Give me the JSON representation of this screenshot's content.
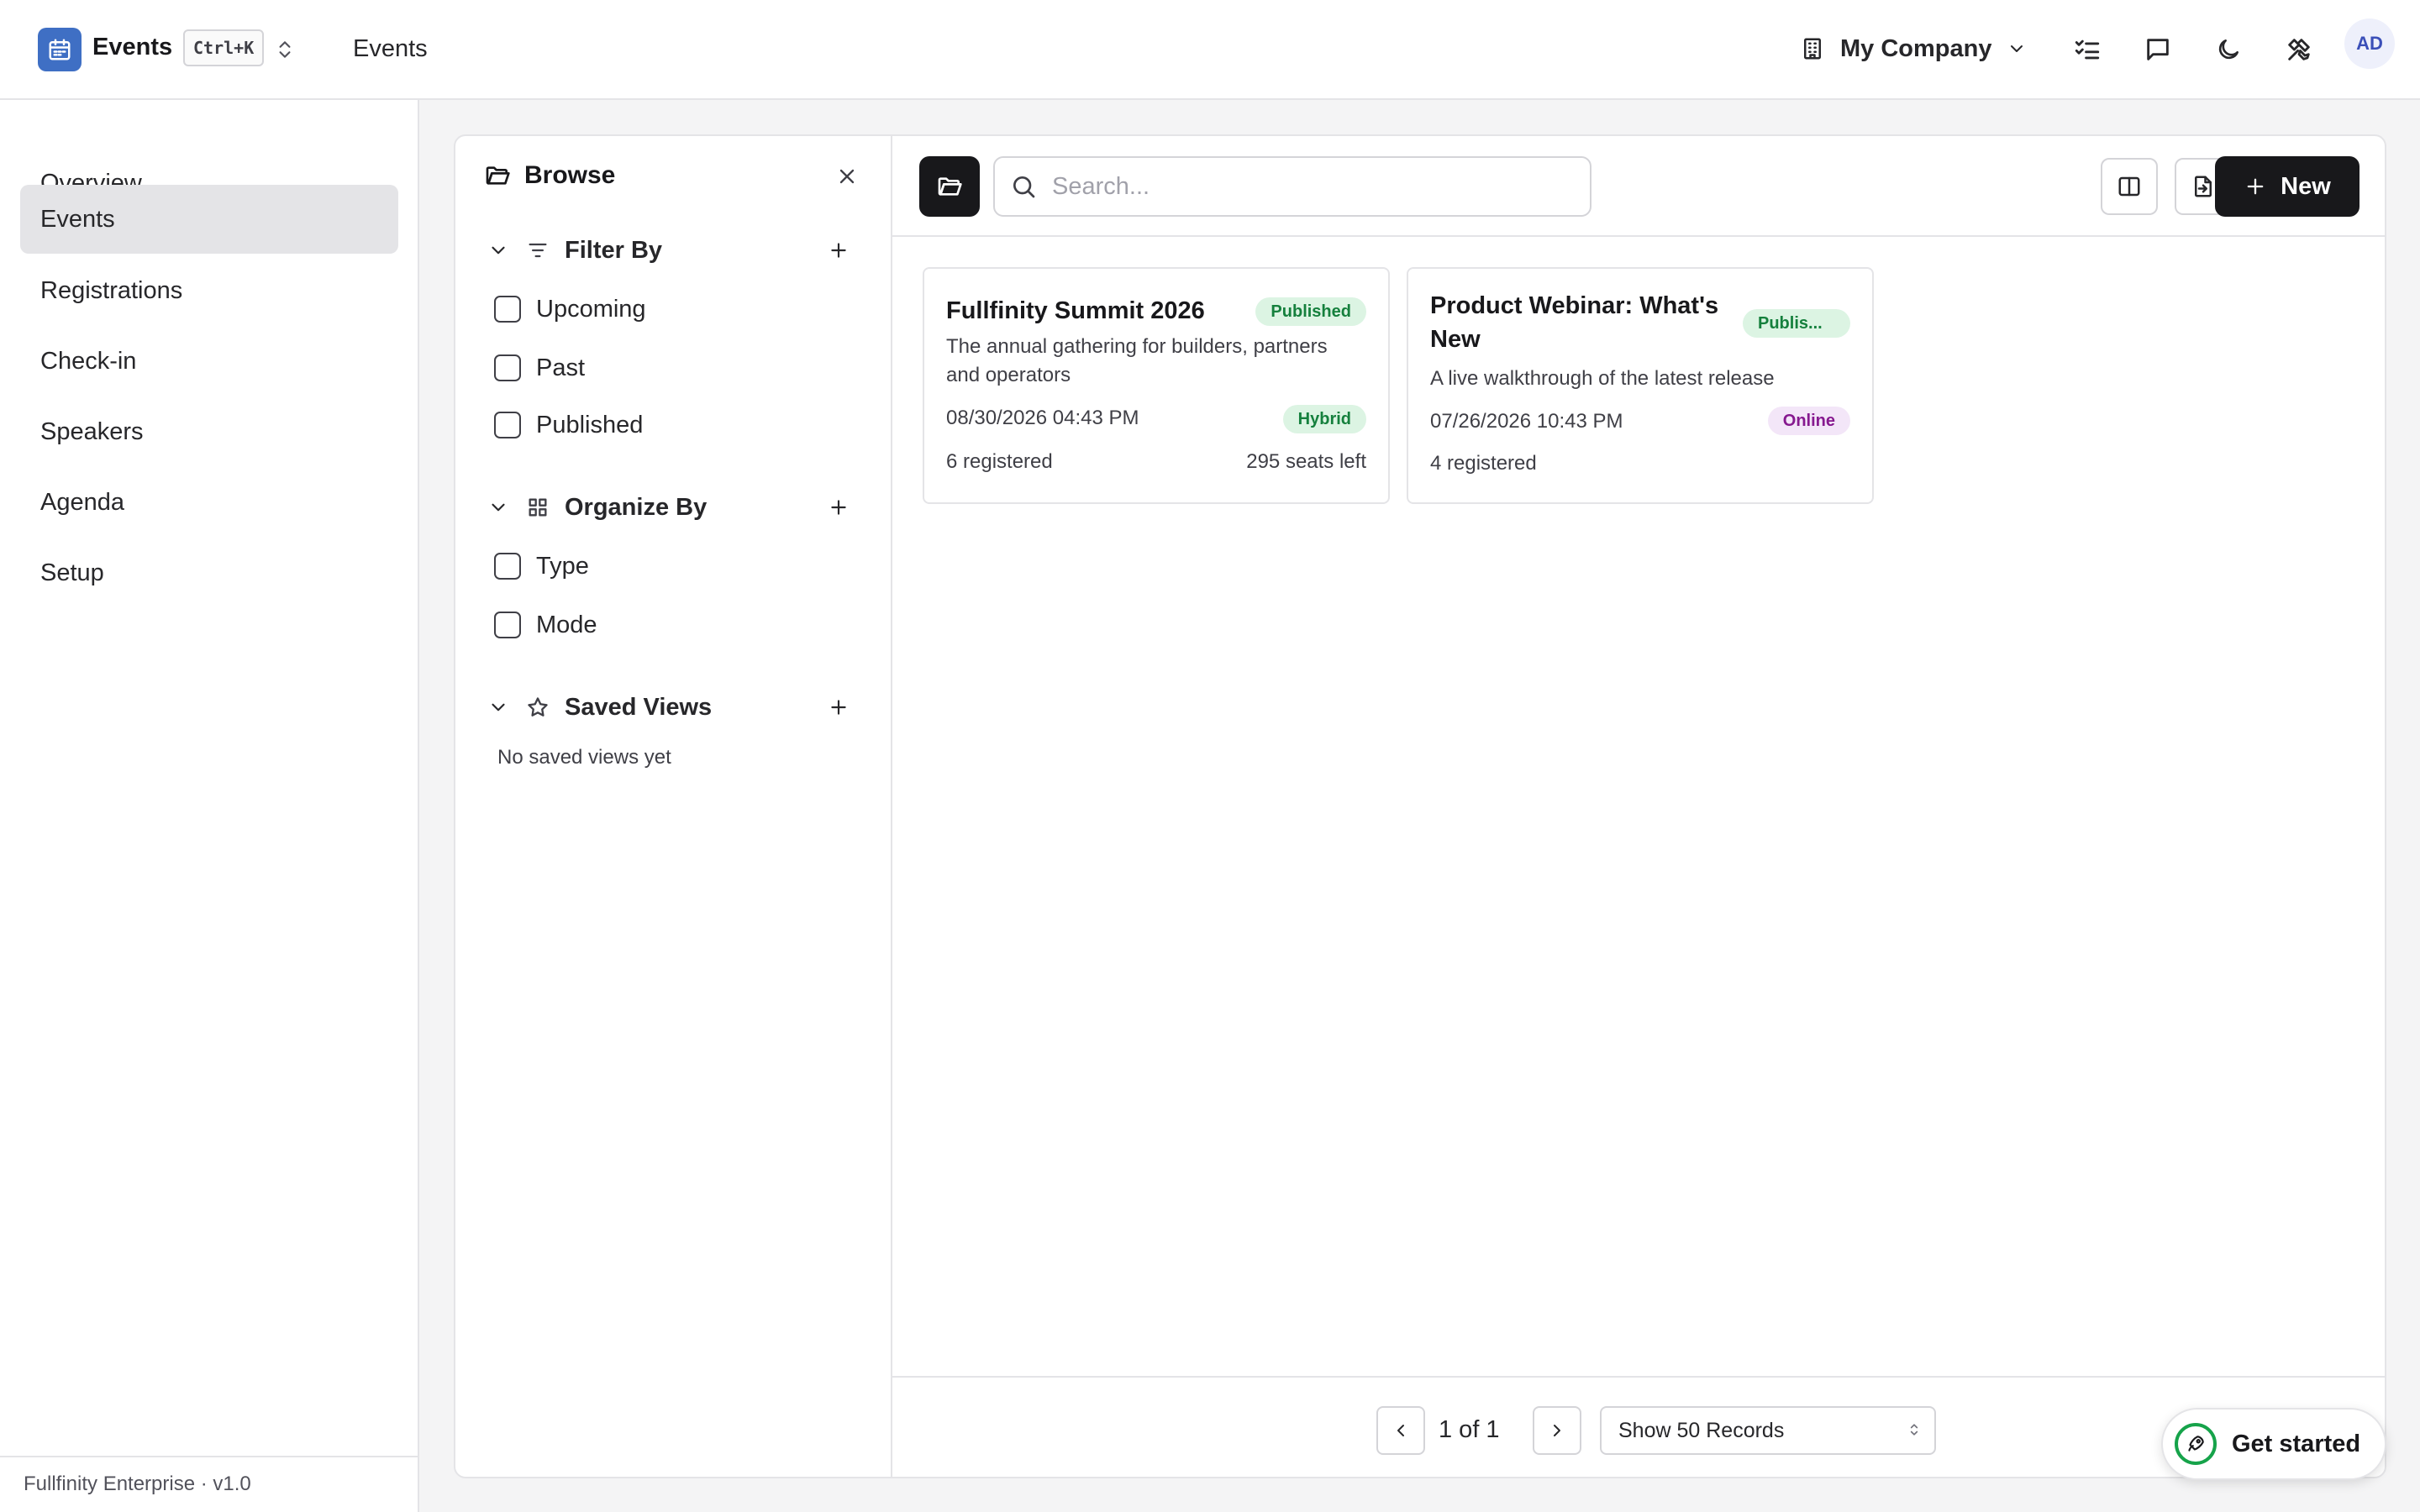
{
  "header": {
    "app_name": "Events",
    "shortcut": "Ctrl+K",
    "breadcrumb": "Events",
    "company": "My Company",
    "avatar_initials": "AD"
  },
  "sidebar": {
    "items": [
      {
        "label": "Overview",
        "active": false
      },
      {
        "label": "Events",
        "active": true
      },
      {
        "label": "Registrations",
        "active": false
      },
      {
        "label": "Check-in",
        "active": false
      },
      {
        "label": "Speakers",
        "active": false
      },
      {
        "label": "Agenda",
        "active": false
      },
      {
        "label": "Setup",
        "active": false
      }
    ],
    "footer": "Fullfinity Enterprise · v1.0"
  },
  "browse": {
    "title": "Browse",
    "filter_by": {
      "label": "Filter By",
      "options": [
        "Upcoming",
        "Past",
        "Published"
      ]
    },
    "organize_by": {
      "label": "Organize By",
      "options": [
        "Type",
        "Mode"
      ]
    },
    "saved_views": {
      "label": "Saved Views",
      "empty": "No saved views yet"
    }
  },
  "toolbar": {
    "search_placeholder": "Search...",
    "new_label": "New"
  },
  "events": [
    {
      "title": "Fullfinity Summit 2026",
      "status": "Published",
      "description": "The annual gathering for builders, partners and operators",
      "datetime": "08/30/2026 04:43 PM",
      "mode": "Hybrid",
      "registered": "6 registered",
      "seats": "295 seats left"
    },
    {
      "title": "Product Webinar: What's New",
      "status": "Publis...",
      "description": "A live walkthrough of the latest release",
      "datetime": "07/26/2026 10:43 PM",
      "mode": "Online",
      "registered": "4 registered",
      "seats": ""
    }
  ],
  "pagination": {
    "page_text": "1 of 1",
    "records_option": "Show 50 Records"
  },
  "help": {
    "get_started": "Get started"
  },
  "colors": {
    "logo_bg": "#3f6fc4",
    "primary_button": "#18181b",
    "published_badge": "#15803d",
    "online_badge": "#86198f"
  }
}
